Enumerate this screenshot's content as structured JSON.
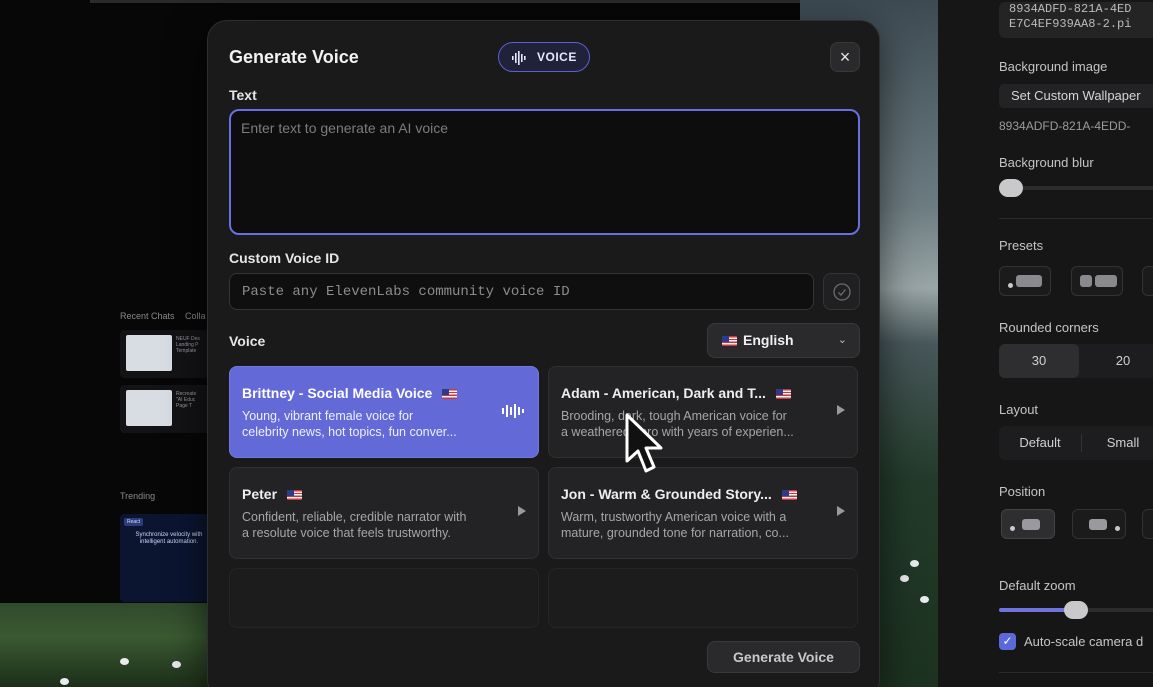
{
  "modal": {
    "title": "Generate Voice",
    "badge": "VOICE",
    "close_icon": "×",
    "text_label": "Text",
    "text_placeholder": "Enter text to generate an AI voice",
    "custom_voice_label": "Custom Voice ID",
    "custom_voice_placeholder": "Paste any ElevenLabs community voice ID",
    "voice_label": "Voice",
    "language": "English",
    "language_chevron": "⌄",
    "generate_label": "Generate Voice",
    "accent_color": "#6469d8",
    "voices": [
      {
        "name": "Brittney - Social Media Voice",
        "desc1": "Young, vibrant female voice for",
        "desc2": "celebrity news, hot topics, fun conver...",
        "selected": true
      },
      {
        "name": "Adam - American, Dark and T...",
        "desc1": "Brooding, dark, tough American voice for",
        "desc2": "a weathered hero with years of experien...",
        "selected": false
      },
      {
        "name": "Peter",
        "desc1": "Confident, reliable, credible narrator with",
        "desc2": "a resolute voice that feels trustworthy.",
        "selected": false
      },
      {
        "name": "Jon - Warm & Grounded Story...",
        "desc1": "Warm, trustworthy American voice with a",
        "desc2": "mature, grounded tone for narration, co...",
        "selected": false
      }
    ]
  },
  "left_panel": {
    "recent_chats": "Recent Chats",
    "collab": "Colla",
    "chat1": "NEUF Des\nLanding P\nTemplate",
    "chat2": "Recreate\n\"AI Educ\nPage T",
    "trending": "Trending",
    "trend_badge": "React",
    "trend_text": "Synchronize velocity with intelligent automation."
  },
  "sidebar": {
    "file_path_1": "8934ADFD-821A-4ED",
    "file_path_2": "E7C4EF939AA8-2.pi",
    "background_image_label": "Background image",
    "set_wallpaper_label": "Set Custom Wallpaper",
    "wallpaper_id": "8934ADFD-821A-4EDD-",
    "background_blur_label": "Background blur",
    "background_blur_level": 0.0,
    "presets_label": "Presets",
    "rounded_corners_label": "Rounded corners",
    "rounded_options": [
      "30",
      "20"
    ],
    "rounded_selected": "30",
    "layout_label": "Layout",
    "layout_options": [
      "Default",
      "Small"
    ],
    "position_label": "Position",
    "default_zoom_label": "Default zoom",
    "default_zoom_level": 0.5,
    "auto_scale_label": "Auto-scale camera d",
    "auto_scale_checked": true
  }
}
